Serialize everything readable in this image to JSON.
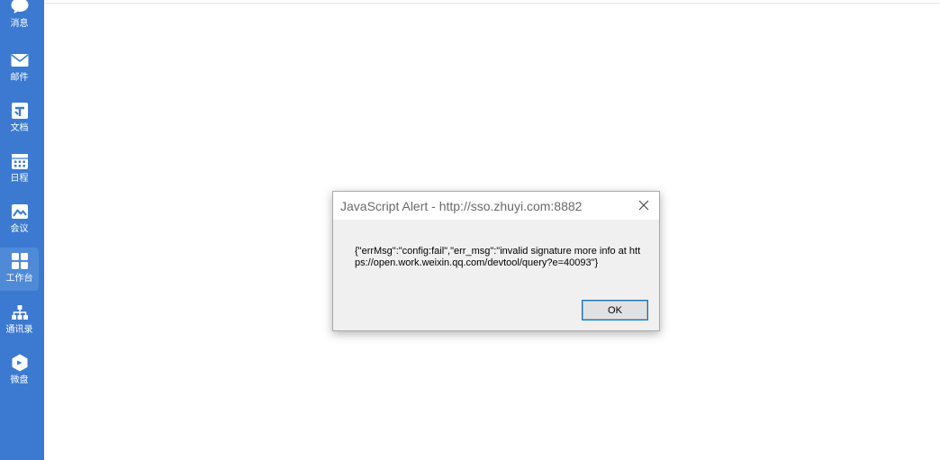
{
  "sidebar": {
    "items": [
      {
        "id": "messages",
        "label": "消息",
        "icon": "chat-bubble-icon",
        "active": false
      },
      {
        "id": "mail",
        "label": "邮件",
        "icon": "mail-icon",
        "active": false
      },
      {
        "id": "docs",
        "label": "文档",
        "icon": "document-icon",
        "active": false
      },
      {
        "id": "calendar",
        "label": "日程",
        "icon": "calendar-icon",
        "active": false
      },
      {
        "id": "meeting",
        "label": "会议",
        "icon": "meeting-icon",
        "active": false
      },
      {
        "id": "workbench",
        "label": "工作台",
        "icon": "grid-apps-icon",
        "active": true
      },
      {
        "id": "contacts",
        "label": "通讯录",
        "icon": "org-chart-icon",
        "active": false
      },
      {
        "id": "drive",
        "label": "微盘",
        "icon": "drive-icon",
        "active": false
      }
    ]
  },
  "dialog": {
    "title": "JavaScript Alert - http://sso.zhuyi.com:8882",
    "message": "{\"errMsg\":\"config:fail\",\"err_msg\":\"invalid signature more info at https://open.work.weixin.qq.com/devtool/query?e=40093\"}",
    "ok_label": "OK"
  },
  "colors": {
    "sidebar_bg": "#3b7ad0",
    "sidebar_active": "#4f8ad6",
    "dialog_bg": "#f0f0f0",
    "button_focus_border": "#0078d7"
  }
}
